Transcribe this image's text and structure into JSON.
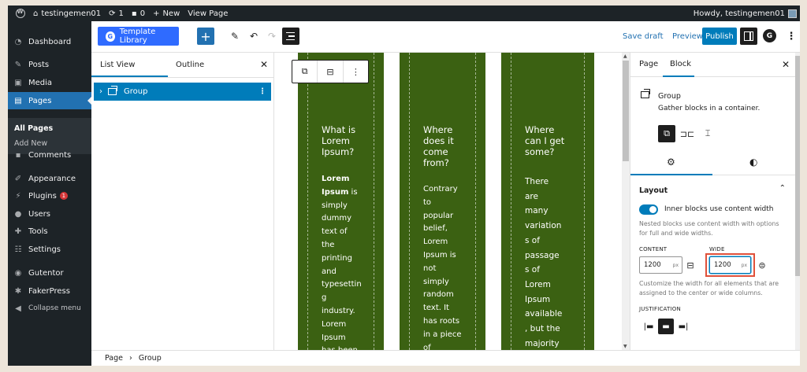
{
  "admin_bar": {
    "site_name": "testingemen01",
    "updates_count": "1",
    "comments_count": "0",
    "new_label": "New",
    "view_page_label": "View Page",
    "howdy": "Howdy, testingemen01"
  },
  "sidebar": {
    "items": [
      {
        "label": "Dashboard",
        "icon": "dashboard-icon"
      },
      {
        "label": "Posts",
        "icon": "pin-icon"
      },
      {
        "label": "Media",
        "icon": "media-icon"
      },
      {
        "label": "Pages",
        "icon": "pages-icon"
      },
      {
        "label": "Comments",
        "icon": "comments-icon"
      },
      {
        "label": "Appearance",
        "icon": "brush-icon"
      },
      {
        "label": "Plugins",
        "icon": "plug-icon",
        "badge": "1"
      },
      {
        "label": "Users",
        "icon": "users-icon"
      },
      {
        "label": "Tools",
        "icon": "wrench-icon"
      },
      {
        "label": "Settings",
        "icon": "settings-icon"
      },
      {
        "label": "Gutentor",
        "icon": "gutentor-icon"
      },
      {
        "label": "FakerPress",
        "icon": "fakerpress-icon"
      },
      {
        "label": "Collapse menu",
        "icon": "collapse-icon"
      }
    ],
    "submenu": [
      "All Pages",
      "Add New"
    ]
  },
  "toolbar": {
    "template_library_label": "Template Library",
    "save_draft_label": "Save draft",
    "preview_label": "Preview",
    "publish_label": "Publish"
  },
  "list_view": {
    "tab_list": "List View",
    "tab_outline": "Outline",
    "row_label": "Group"
  },
  "canvas": {
    "columns": [
      {
        "heading": "What is\nLorem\nIpsum?",
        "bold_lead": "Lorem\nIpsum",
        "text": " is\nsimply\ndummy\ntext of\nthe\nprinting\nand\ntypesettin\ng\nindustry.\nLorem\nIpsum\nhas been"
      },
      {
        "heading": "Where\ndoes it\ncome\nfrom?",
        "bold_lead": "",
        "text": "Contrary\nto\npopular\nbelief,\nLorem\nIpsum is\nnot\nsimply\nrandom\ntext. It\nhas roots\nin a piece\nof"
      },
      {
        "heading": "Where\ncan I get\nsome?",
        "bold_lead": "",
        "text": "There\nare\nmany\nvariation\ns of\npassage\ns of\nLorem\nIpsum\navailable\n, but the\nmajority"
      }
    ],
    "column_color": "#3b6112"
  },
  "inspector": {
    "tab_page": "Page",
    "tab_block": "Block",
    "block_title": "Group",
    "block_desc": "Gather blocks in a container.",
    "layout_title": "Layout",
    "toggle_label": "Inner blocks use content width",
    "toggle_on": true,
    "help_nested": "Nested blocks use content width with options for full and wide widths.",
    "content_label": "CONTENT",
    "content_value": "1200",
    "wide_label": "WIDE",
    "wide_value": "1200",
    "unit": "px",
    "help_customize": "Customize the width for all elements that are assigned to the center or wide columns.",
    "justification_label": "JUSTIFICATION"
  },
  "footer": {
    "crumb_page": "Page",
    "crumb_group": "Group"
  },
  "colors": {
    "accent": "#007cba",
    "highlight_box": "#e0513a",
    "template_button": "#2f6bff"
  }
}
